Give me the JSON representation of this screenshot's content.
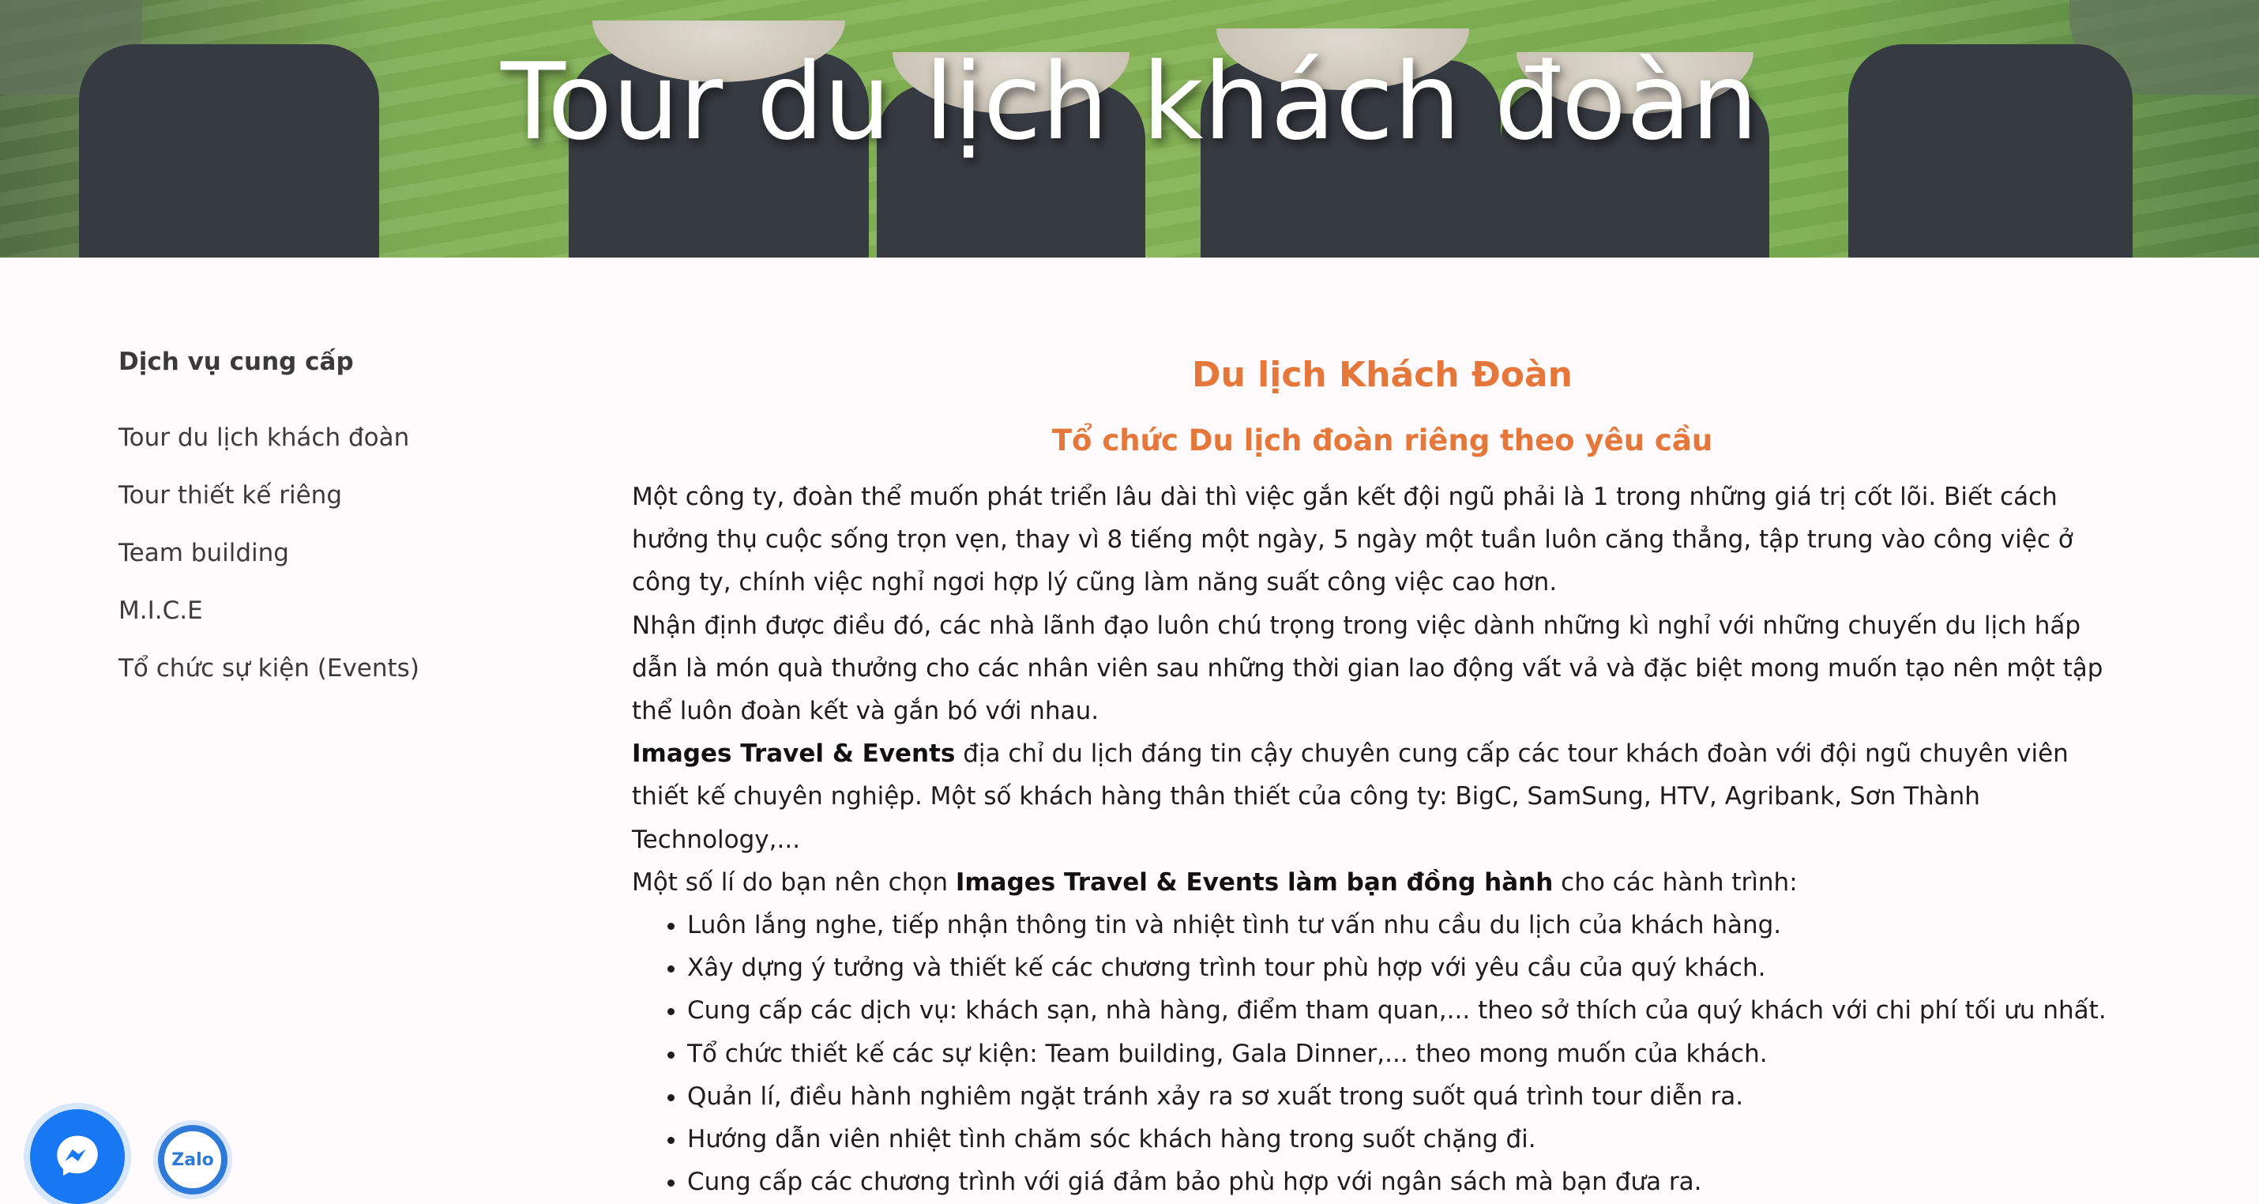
{
  "hero": {
    "title": "Tour du lịch khách đoàn",
    "image_desc": "group-wearing-conical-hats-rice-field"
  },
  "sidebar": {
    "heading": "Dịch vụ cung cấp",
    "items": [
      {
        "label": "Tour du lịch khách đoàn"
      },
      {
        "label": "Tour thiết kế riêng"
      },
      {
        "label": "Team building"
      },
      {
        "label": "M.I.C.E"
      },
      {
        "label": "Tổ chức sự kiện (Events)"
      }
    ]
  },
  "main": {
    "title": "Du lịch Khách Đoàn",
    "subtitle": "Tổ chức Du lịch đoàn riêng theo yêu cầu",
    "para1": " Một công ty, đoàn thể muốn phát triển lâu dài thì việc gắn kết đội ngũ phải là 1 trong những giá trị cốt lõi. Biết cách hưởng thụ cuộc sống trọn vẹn, thay vì 8 tiếng một ngày, 5 ngày một tuần luôn căng thẳng, tập trung vào công việc ở công ty, chính việc nghỉ ngơi hợp lý cũng làm năng suất công việc cao hơn.",
    "para2": "Nhận định được điều đó, các nhà lãnh đạo luôn chú trọng trong việc dành những kì nghỉ với những chuyến du lịch hấp dẫn là món quà thưởng cho các nhân viên sau những thời gian lao động vất vả và đặc biệt mong muốn tạo nên một tập thể luôn đoàn kết và gắn bó với nhau.",
    "para3_bold": "Images Travel & Events",
    "para3_rest": " địa chỉ du lịch đáng tin cậy chuyên cung cấp các tour khách đoàn với đội ngũ chuyên viên thiết kế chuyên nghiệp. Một số khách hàng thân thiết của công ty: BigC, SamSung, HTV, Agribank, Sơn Thành Technology,...",
    "para4_start": "Một số lí do bạn nên chọn ",
    "para4_bold": "Images Travel & Events làm bạn đồng hành",
    "para4_end": " cho các hành trình:",
    "reasons": [
      "Luôn lắng nghe, tiếp nhận thông tin và nhiệt tình tư vấn nhu cầu du lịch của khách hàng.",
      "Xây dựng ý tưởng và thiết kế các chương trình tour phù hợp với yêu cầu của quý khách.",
      "Cung cấp các dịch vụ: khách sạn, nhà hàng, điểm tham quan,... theo sở thích của quý khách với chi phí tối ưu nhất.",
      "Tổ chức thiết kế các sự kiện: Team building, Gala Dinner,... theo mong muốn của khách.",
      "Quản lí, điều hành nghiêm ngặt tránh xảy ra sơ xuất trong suốt quá trình tour diễn ra.",
      "Hướng dẫn viên nhiệt tình chăm sóc khách hàng trong suốt chặng đi.",
      "Cung cấp các chương trình với giá đảm bảo phù hợp với ngân sách mà bạn đưa ra."
    ]
  },
  "floating": {
    "messenger_icon": "messenger-icon",
    "zalo_label": "Zalo"
  },
  "colors": {
    "accent": "#e5773a",
    "messenger": "#1877f2",
    "zalo": "#2f7ad8",
    "background": "#fffafb"
  }
}
